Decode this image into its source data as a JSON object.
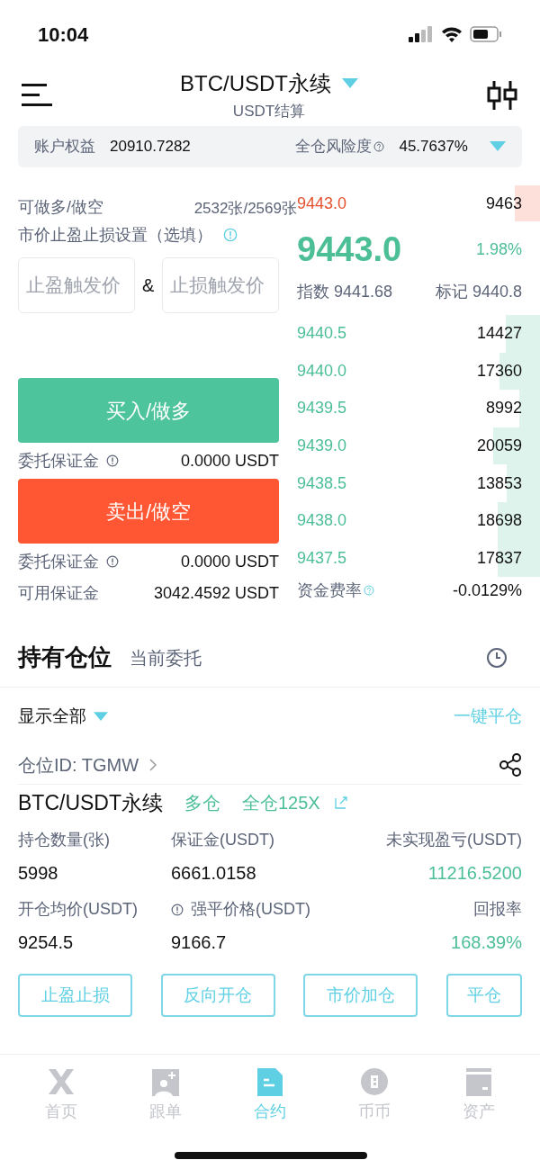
{
  "status_bar": {
    "time": "10:04"
  },
  "header": {
    "title": "BTC/USDT永续",
    "subtitle": "USDT结算"
  },
  "account": {
    "equity_label": "账户权益",
    "equity": "20910.7282",
    "risk_label": "全仓风险度",
    "risk": "45.7637%"
  },
  "order_form": {
    "available_label": "可做多/做空",
    "available": "2532张/2569张",
    "tpsl_label": "市价止盈止损设置（选填）",
    "tp_placeholder": "止盈触发价",
    "amp": "&",
    "sl_placeholder": "止损触发价",
    "buy_button": "买入/做多",
    "buy_margin_label": "委托保证金",
    "buy_margin": "0.0000 USDT",
    "sell_button": "卖出/做空",
    "sell_margin_label": "委托保证金",
    "sell_margin": "0.0000 USDT",
    "avail_margin_label": "可用保证金",
    "avail_margin": "3042.4592 USDT"
  },
  "order_book": {
    "asks": [
      {
        "price": "9443.0",
        "qty": "9463"
      }
    ],
    "last_price": "9443.0",
    "change": "1.98%",
    "index": "指数 9441.68",
    "mark": "标记 9440.8",
    "bids": [
      {
        "price": "9440.5",
        "qty": "14427"
      },
      {
        "price": "9440.0",
        "qty": "17360"
      },
      {
        "price": "9439.5",
        "qty": "8992"
      },
      {
        "price": "9439.0",
        "qty": "20059"
      },
      {
        "price": "9438.5",
        "qty": "13853"
      },
      {
        "price": "9438.0",
        "qty": "18698"
      },
      {
        "price": "9437.5",
        "qty": "17837"
      }
    ],
    "funding_label": "资金费率",
    "funding": "-0.0129%"
  },
  "tabs": [
    {
      "label": "持有仓位",
      "selected": true
    },
    {
      "label": "当前委托",
      "selected": false
    }
  ],
  "filter": {
    "label": "显示全部",
    "close_all": "一键平仓"
  },
  "position": {
    "id": "仓位ID: TGMW",
    "symbol": "BTC/USDT永续",
    "side": "多仓",
    "mode": "全仓125X",
    "fields": [
      {
        "label": "持仓数量(张)",
        "value": "5998",
        "positive": false,
        "info": false
      },
      {
        "label": "保证金(USDT)",
        "value": "6661.0158",
        "positive": false,
        "info": false
      },
      {
        "label": "未实现盈亏(USDT)",
        "value": "11216.5200",
        "positive": true,
        "info": false
      },
      {
        "label": "开仓均价(USDT)",
        "value": "9254.5",
        "positive": false,
        "info": false
      },
      {
        "label": "强平价格(USDT)",
        "value": "9166.7",
        "positive": false,
        "info": true
      },
      {
        "label": "回报率",
        "value": "168.39%",
        "positive": true,
        "info": false
      }
    ],
    "actions": [
      "止盈止损",
      "反向开仓",
      "市价加仓",
      "平仓"
    ]
  },
  "nav": [
    {
      "label": "首页",
      "selected": false
    },
    {
      "label": "跟单",
      "selected": false
    },
    {
      "label": "合约",
      "selected": true
    },
    {
      "label": "币币",
      "selected": false
    },
    {
      "label": "资产",
      "selected": false
    }
  ]
}
